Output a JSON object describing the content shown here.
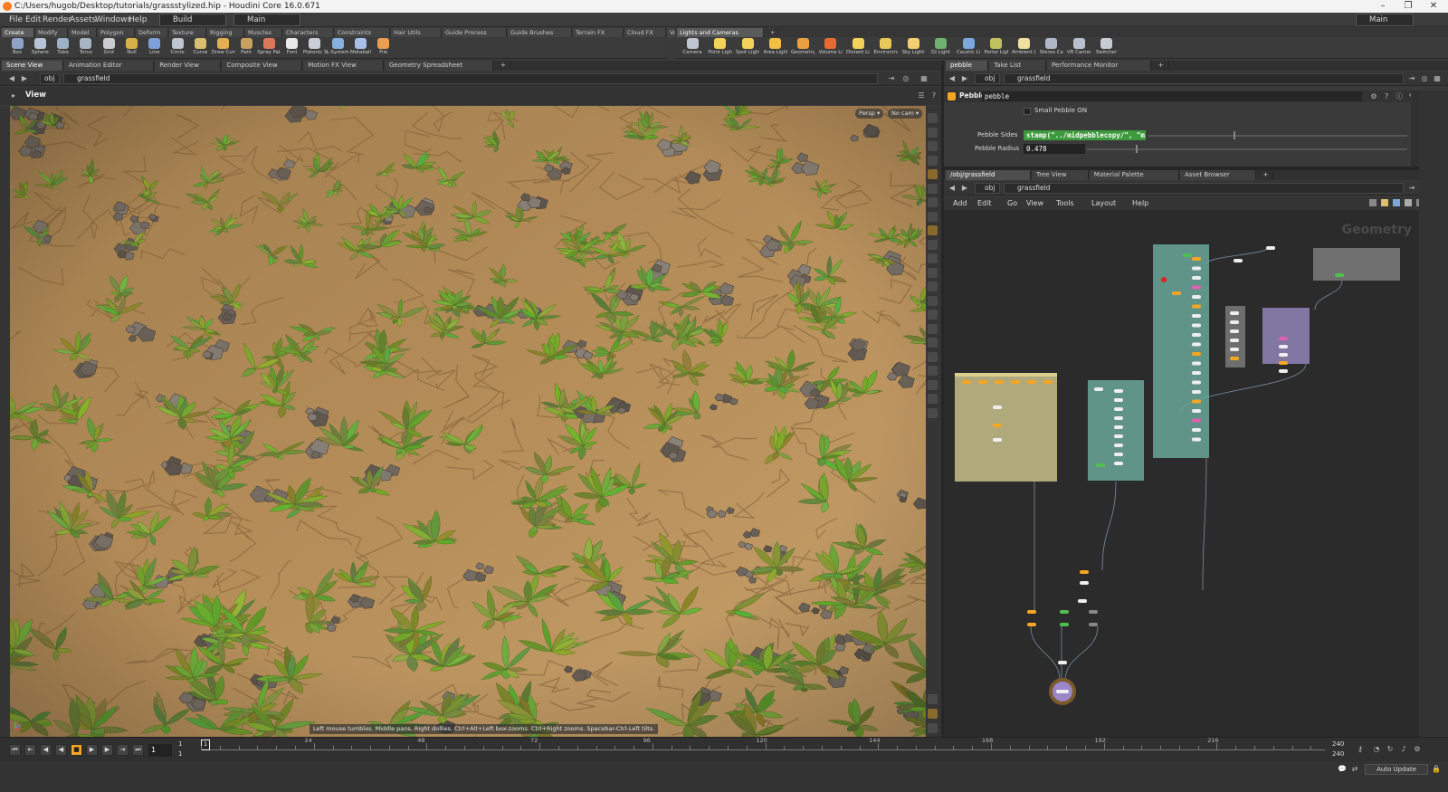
{
  "window": {
    "title": "C:/Users/hugob/Desktop/tutorials/grassstylized.hip - Houdini Core 16.0.671",
    "minimize": "–",
    "maximize": "❐",
    "close": "✕"
  },
  "menubar": {
    "items": [
      "File",
      "Edit",
      "Render",
      "Assets",
      "Windows",
      "Help"
    ],
    "build_label": "Build",
    "desktop_label": "Main",
    "right_desktop_label": "Main"
  },
  "shelf_left": {
    "tabs": [
      "Create",
      "Modify",
      "Model",
      "Polygon",
      "Deform",
      "Texture",
      "Rigging",
      "Muscles",
      "Characters",
      "Constraints",
      "Hair Utils",
      "Guide Process",
      "Guide Brushes",
      "Terrain FX",
      "Cloud FX",
      "Volume"
    ],
    "add": "+",
    "tools": [
      {
        "label": "Box",
        "color": "#8fa3c4"
      },
      {
        "label": "Sphere",
        "color": "#b7c3d6"
      },
      {
        "label": "Tube",
        "color": "#9fb0c9"
      },
      {
        "label": "Torus",
        "color": "#a8b4c6"
      },
      {
        "label": "Grid",
        "color": "#c9cbd0"
      },
      {
        "label": "Null",
        "color": "#d8b04a"
      },
      {
        "label": "Line",
        "color": "#7fa0d8"
      },
      {
        "label": "Circle",
        "color": "#c0c6d0"
      },
      {
        "label": "Curve",
        "color": "#d6c070"
      },
      {
        "label": "Draw Curve",
        "color": "#e0b050"
      },
      {
        "label": "Path",
        "color": "#c8a060"
      },
      {
        "label": "Spray Paint",
        "color": "#d87a5a"
      },
      {
        "label": "Font",
        "color": "#e8e8e8"
      },
      {
        "label": "Platonic Solids",
        "color": "#c9ced8"
      },
      {
        "label": "L-System",
        "color": "#86b0e0"
      },
      {
        "label": "Metaball",
        "color": "#a8c0e8"
      },
      {
        "label": "File",
        "color": "#e8a050"
      }
    ]
  },
  "shelf_right": {
    "tabs": [
      "Lights and Cameras"
    ],
    "add": "+",
    "tools": [
      {
        "label": "Camera",
        "color": "#bfc6d2"
      },
      {
        "label": "Point Light",
        "color": "#f2d25a"
      },
      {
        "label": "Spot Light",
        "color": "#f2d25a"
      },
      {
        "label": "Area Light",
        "color": "#f0c040"
      },
      {
        "label": "Geometry Light",
        "color": "#e8a040"
      },
      {
        "label": "Volume Light",
        "color": "#e86a30"
      },
      {
        "label": "Distant Light",
        "color": "#f2d25a"
      },
      {
        "label": "Environment Light",
        "color": "#e8c858"
      },
      {
        "label": "Sky Light",
        "color": "#f0d070"
      },
      {
        "label": "GI Light",
        "color": "#70b070"
      },
      {
        "label": "Caustic Light",
        "color": "#7aa8e0"
      },
      {
        "label": "Portal Light",
        "color": "#c0c060"
      },
      {
        "label": "Ambient Light",
        "color": "#f0e0a0"
      },
      {
        "label": "Stereo Camera",
        "color": "#b0b8c8"
      },
      {
        "label": "VR Camera",
        "color": "#b8c0d0"
      },
      {
        "label": "Switcher",
        "color": "#c8ccd4"
      }
    ]
  },
  "left_pane": {
    "tabs": [
      "Scene View",
      "Animation Editor",
      "Render View",
      "Composite View",
      "Motion FX View",
      "Geometry Spreadsheet"
    ],
    "add": "+",
    "path": {
      "root": "obj",
      "node": "grassfield"
    },
    "view_label": "View",
    "persp_label": "Persp ▾",
    "cam_label": "No cam ▾",
    "hint": "Left mouse tumbles. Middle pans. Right dollies. Ctrl+Alt+Left box-zooms. Ctrl+Right zooms. Spacebar-Ctrl-Left tilts."
  },
  "param_pane": {
    "tabs": [
      "pebble",
      "Take List",
      "Performance Monitor"
    ],
    "add": "+",
    "path": {
      "root": "obj",
      "node": "grassfield"
    },
    "node_type": "Pebble",
    "node_name": "pebble",
    "toggle_label": "Small Pebble ON",
    "sides_label": "Pebble Sides",
    "sides_value": "stamp(\"../midpebblecopy/\", \"mic",
    "radius_label": "Pebble Radius",
    "radius_value": "0.478",
    "radius_fraction": 0.48
  },
  "network_pane": {
    "tabs": [
      "/obj/grassfield",
      "Tree View",
      "Material Palette",
      "Asset Browser"
    ],
    "add": "+",
    "path": {
      "root": "obj",
      "node": "grassfield"
    },
    "menu": [
      "Add",
      "Edit",
      "Go",
      "View",
      "Tools",
      "Layout",
      "Help"
    ],
    "context_label": "Geometry"
  },
  "timeline": {
    "current_frame": "1",
    "start_frame": "1",
    "range_start": "1",
    "end_frame": "240",
    "range_end": "240",
    "ticks": [
      "24",
      "48",
      "72",
      "96",
      "120",
      "144",
      "168",
      "192",
      "216"
    ],
    "auto_update_label": "Auto Update"
  },
  "colors": {
    "accent": "#f5a623",
    "net_teal": "#6aa79a",
    "net_khaki": "#c8c08a",
    "net_purple": "#9b86c9"
  }
}
